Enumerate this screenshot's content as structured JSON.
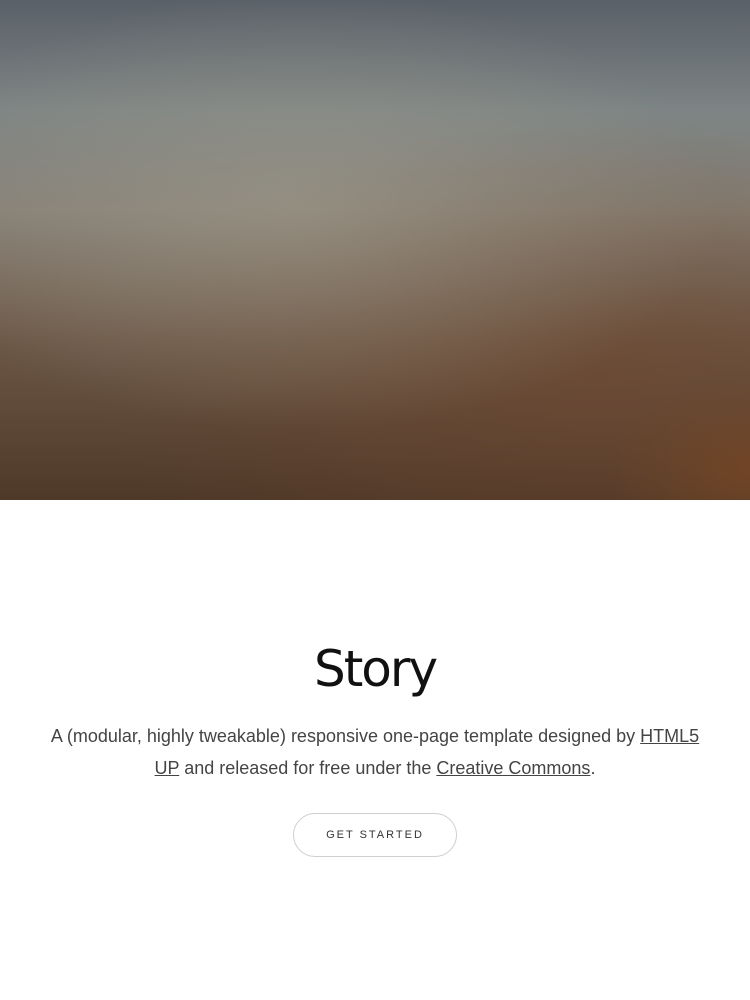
{
  "hero": {
    "image": "blurred-landscape-photo"
  },
  "banner": {
    "title": "Story",
    "description_prefix": "A (modular, highly tweakable) responsive one-page template designed by ",
    "link_html5up": "HTML5 UP",
    "description_middle": " and released for free under the ",
    "link_cc": "Creative Commons",
    "description_suffix": ".",
    "cta_label": "GET STARTED"
  }
}
